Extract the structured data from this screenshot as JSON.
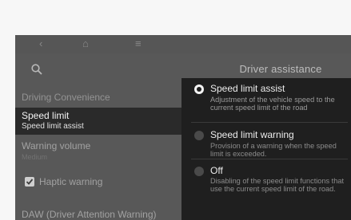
{
  "nav": {
    "back_icon": "‹",
    "home_icon": "⌂",
    "menu_icon": "≡"
  },
  "header": {
    "title": "Driver assistance"
  },
  "left_menu": {
    "section_label": "Driving Convenience",
    "selected_item": {
      "label": "Speed limit",
      "value": "Speed limit assist"
    },
    "warning_volume": {
      "label": "Warning volume",
      "value": "Medium"
    },
    "haptic_warning": {
      "label": "Haptic warning",
      "checked": true
    },
    "daw_label": "DAW (Driver Attention Warning)"
  },
  "popup": {
    "options": [
      {
        "title": "Speed limit assist",
        "description": "Adjustment of the vehicle speed to the current speed limit of the road",
        "selected": true
      },
      {
        "title": "Speed limit warning",
        "description": "Provision of a warning when the speed limit is exceeded.",
        "selected": false
      },
      {
        "title": "Off",
        "description": "Disabling of the speed limit functions that use the current speed limit of the road.",
        "selected": false
      }
    ]
  },
  "colors": {
    "screen_bg": "#585858",
    "popup_bg": "#1f1f1f",
    "selected_row_bg": "#2a2a2a"
  }
}
